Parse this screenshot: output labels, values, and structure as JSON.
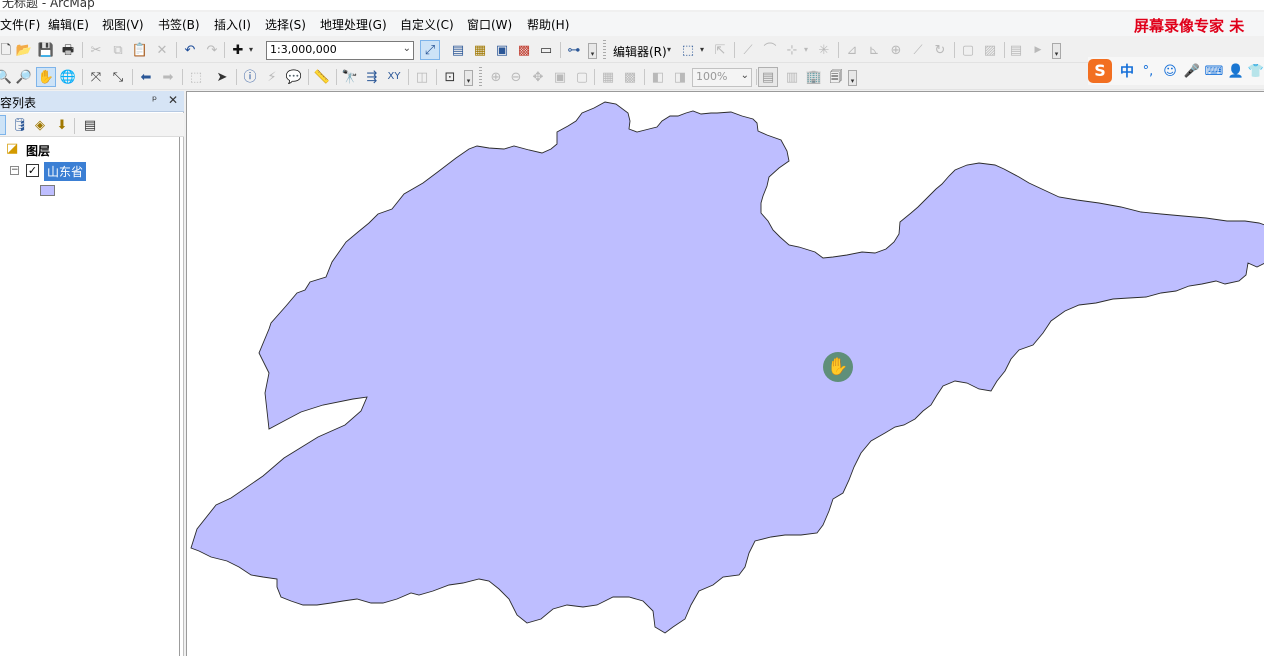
{
  "window": {
    "title": "无标题 - ArcMap"
  },
  "menu": {
    "items": [
      "文件(F)",
      "编辑(E)",
      "视图(V)",
      "书签(B)",
      "插入(I)",
      "选择(S)",
      "地理处理(G)",
      "自定义(C)",
      "窗口(W)",
      "帮助(H)"
    ],
    "recorder_label": "屏幕录像专家 未"
  },
  "toolbar1": {
    "scale_value": "1:3,000,000",
    "editor_label": "编辑器(R)",
    "icons": [
      "new-doc-icon",
      "open-icon",
      "save-icon",
      "print-icon",
      "cut-icon",
      "copy-icon",
      "paste-icon",
      "delete-icon",
      "undo-icon",
      "redo-icon",
      "add-data-icon"
    ]
  },
  "toolbar2": {
    "zoom_value": "100%"
  },
  "ime": {
    "chinese_label": "中"
  },
  "toc": {
    "title": "容列表",
    "pin_glyph": "ᵖ",
    "close_glyph": "✕",
    "root_label": "图层",
    "layer": {
      "name": "山东省",
      "checked": true,
      "fill_color": "#bebeff"
    },
    "expander_glyph": "−",
    "check_glyph": "✓"
  },
  "map": {
    "feature_fill": "#bebeff",
    "feature_stroke": "#2b2b2b",
    "background": "#ffffff",
    "cursor_icon": "pan-hand-icon"
  }
}
